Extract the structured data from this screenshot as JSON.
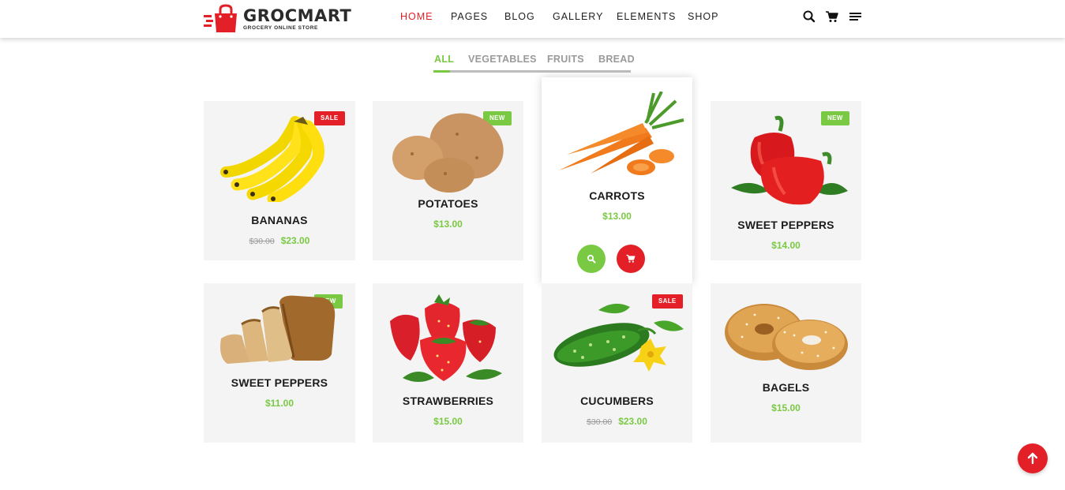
{
  "brand": {
    "name": "GROCMART",
    "tagline": "GROCERY ONLINE STORE",
    "accent": "#e32027",
    "green": "#7ac943"
  },
  "nav": {
    "items": [
      "HOME",
      "PAGES",
      "BLOG",
      "GALLERY",
      "ELEMENTS",
      "SHOP"
    ],
    "active": "HOME"
  },
  "header_icons": [
    "search-icon",
    "cart-icon",
    "menu-icon"
  ],
  "filters": {
    "items": [
      "ALL",
      "VEGETABLES",
      "FRUITS",
      "BREAD"
    ],
    "active": "ALL"
  },
  "products": [
    {
      "name": "BANANAS",
      "old_price": "$30.00",
      "price": "$23.00",
      "badge": "SALE"
    },
    {
      "name": "POTATOES",
      "old_price": "",
      "price": "$13.00",
      "badge": "NEW"
    },
    {
      "name": "CARROTS",
      "old_price": "",
      "price": "$13.00",
      "badge": ""
    },
    {
      "name": "SWEET PEPPERS",
      "old_price": "",
      "price": "$14.00",
      "badge": "NEW"
    },
    {
      "name": "SWEET PEPPERS",
      "old_price": "",
      "price": "$11.00",
      "badge": "NEW"
    },
    {
      "name": "STRAWBERRIES",
      "old_price": "",
      "price": "$15.00",
      "badge": ""
    },
    {
      "name": "CUCUMBERS",
      "old_price": "$30.00",
      "price": "$23.00",
      "badge": "SALE"
    },
    {
      "name": "BAGELS",
      "old_price": "",
      "price": "$15.00",
      "badge": ""
    }
  ],
  "card_actions": [
    "search-icon",
    "cart-icon"
  ],
  "scroll_top": "arrow-up-icon"
}
